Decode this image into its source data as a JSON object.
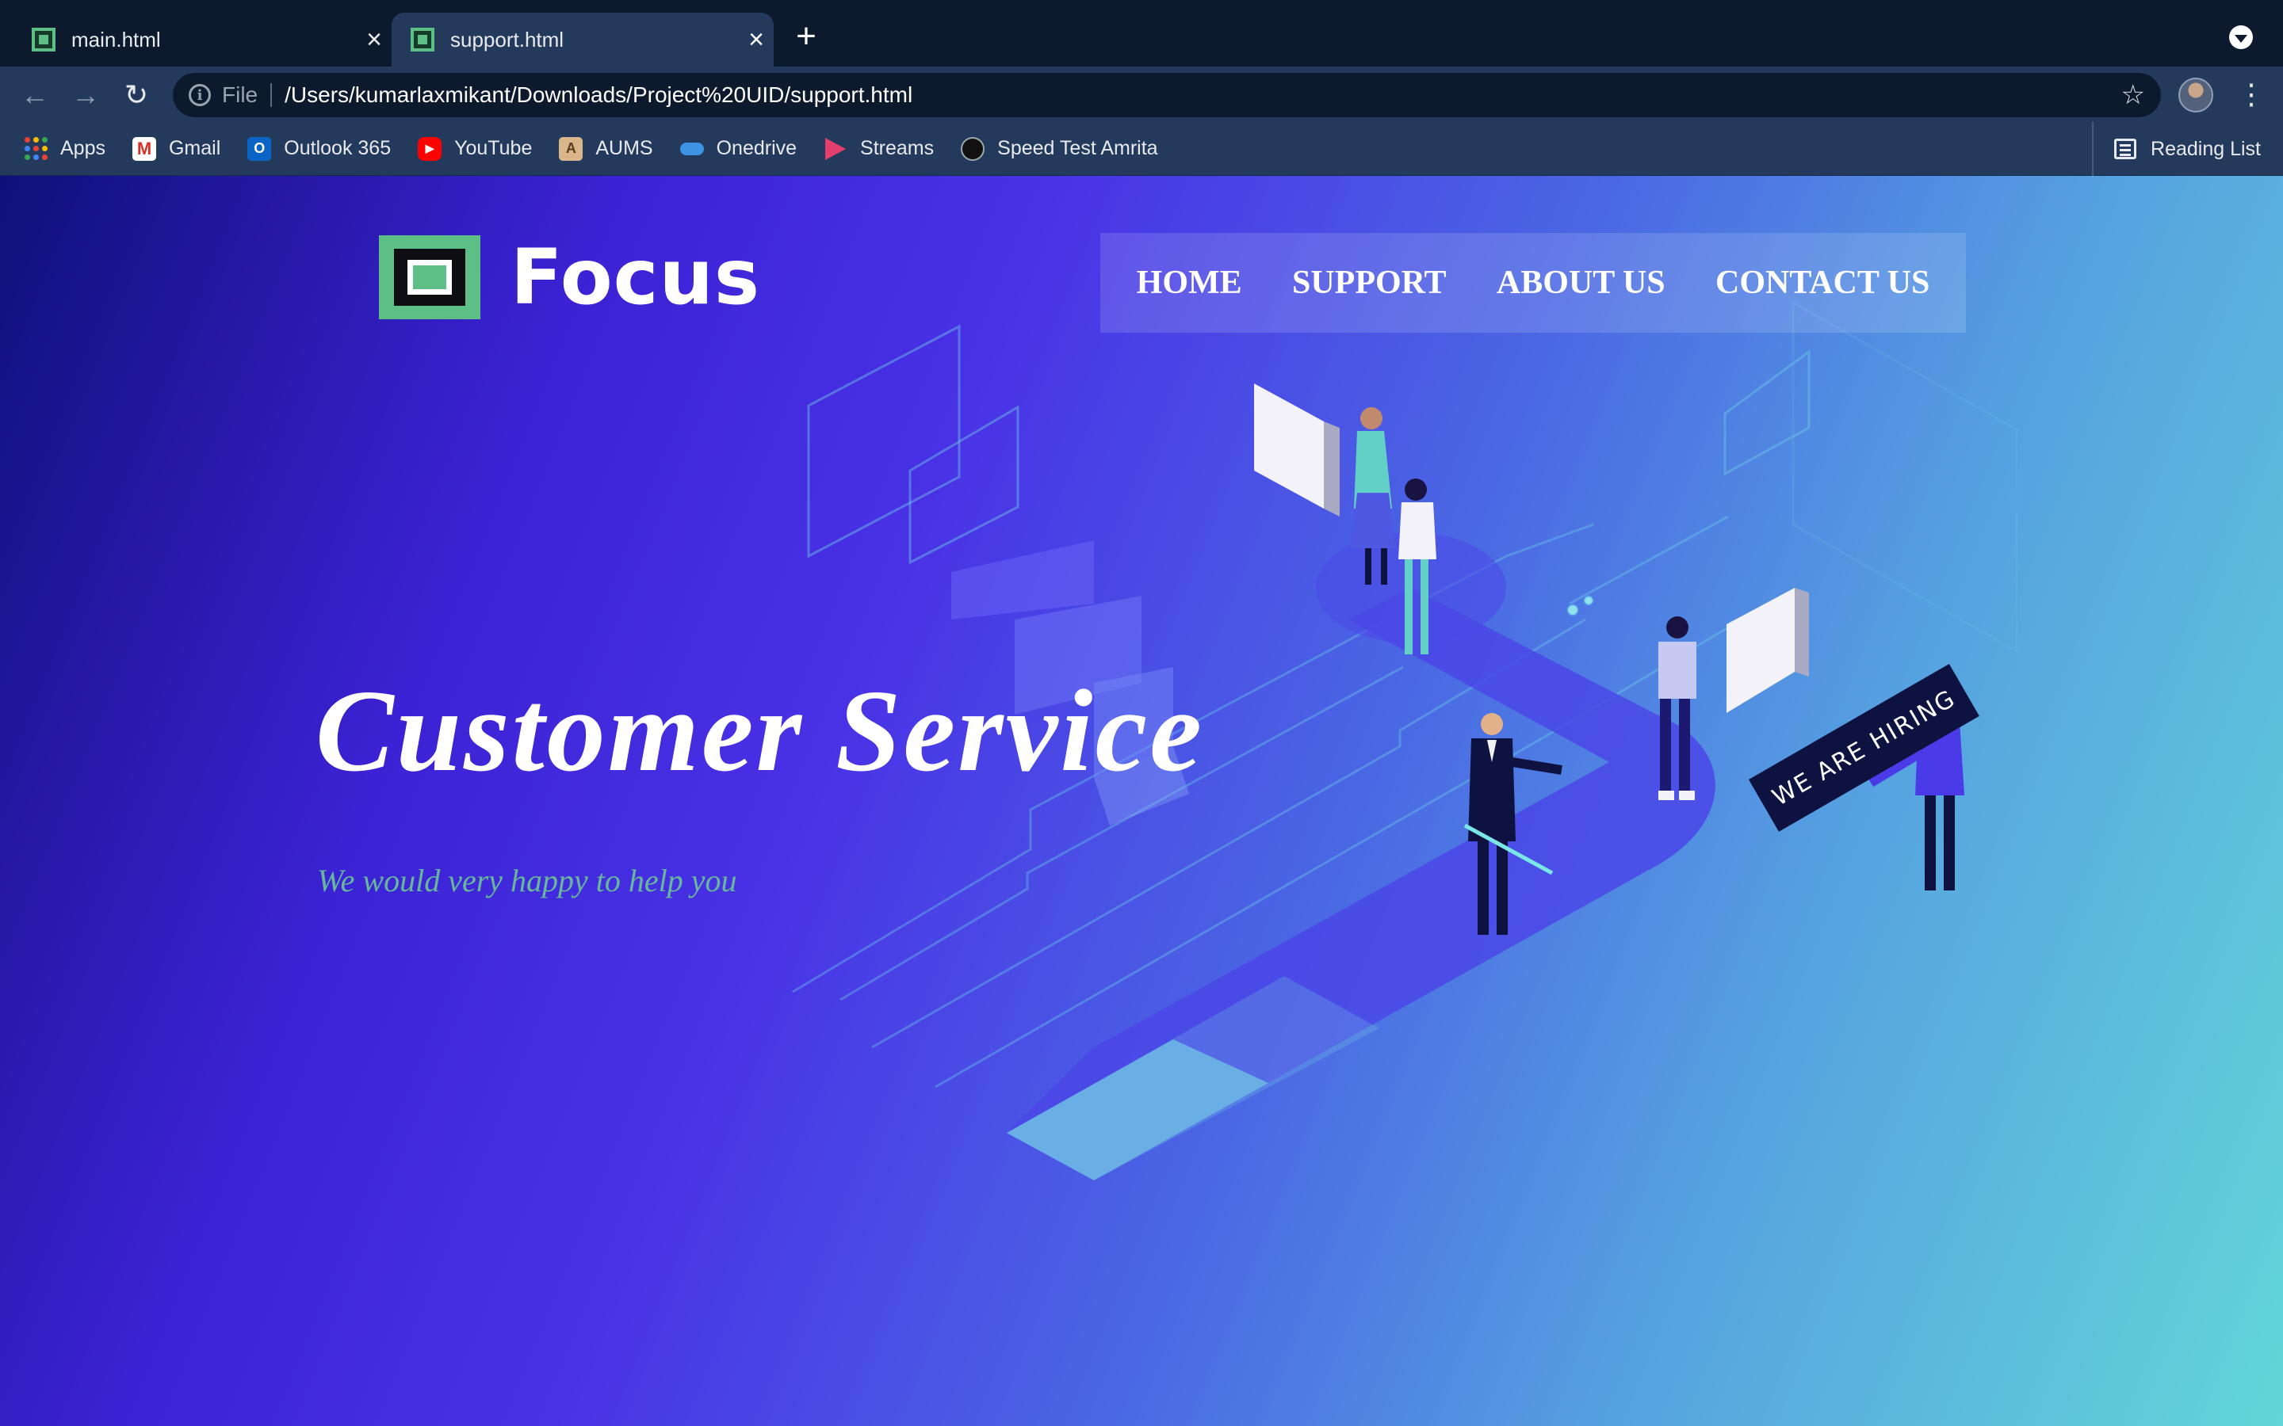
{
  "browser": {
    "tabs": [
      {
        "title": "main.html"
      },
      {
        "title": "support.html"
      }
    ],
    "new_tab_symbol": "+",
    "close_symbol": "×",
    "back_symbol": "←",
    "forward_symbol": "→",
    "reload_symbol": "↻",
    "info_symbol": "i",
    "scheme_label": "File",
    "url": "/Users/kumarlaxmikant/Downloads/Project%20UID/support.html",
    "star_symbol": "☆",
    "menu_symbol": "⋮",
    "bookmarks": [
      {
        "label": "Apps",
        "icon": "apps-grid-icon"
      },
      {
        "label": "Gmail",
        "icon": "gmail-icon",
        "glyph": "M"
      },
      {
        "label": "Outlook 365",
        "icon": "outlook-icon",
        "glyph": "O"
      },
      {
        "label": "YouTube",
        "icon": "youtube-icon",
        "glyph": "▶"
      },
      {
        "label": "AUMS",
        "icon": "aums-icon",
        "glyph": "A"
      },
      {
        "label": "Onedrive",
        "icon": "onedrive-icon"
      },
      {
        "label": "Streams",
        "icon": "streams-icon"
      },
      {
        "label": "Speed Test Amrita",
        "icon": "speedtest-icon"
      }
    ],
    "reading_list": "Reading List"
  },
  "page": {
    "brand": "Focus",
    "nav": [
      "HOME",
      "SUPPORT",
      "ABOUT US",
      "CONTACT US"
    ],
    "hero_title": "Customer Service",
    "hero_subtitle": "We would very happy to help you",
    "hiring_sign": "WE ARE HIRING"
  },
  "colors": {
    "brand_green": "#5ebf86",
    "subtitle_green": "#67b89a",
    "gradient_start": "#10107a",
    "gradient_mid": "#4932e6",
    "gradient_end": "#62d6d8"
  }
}
